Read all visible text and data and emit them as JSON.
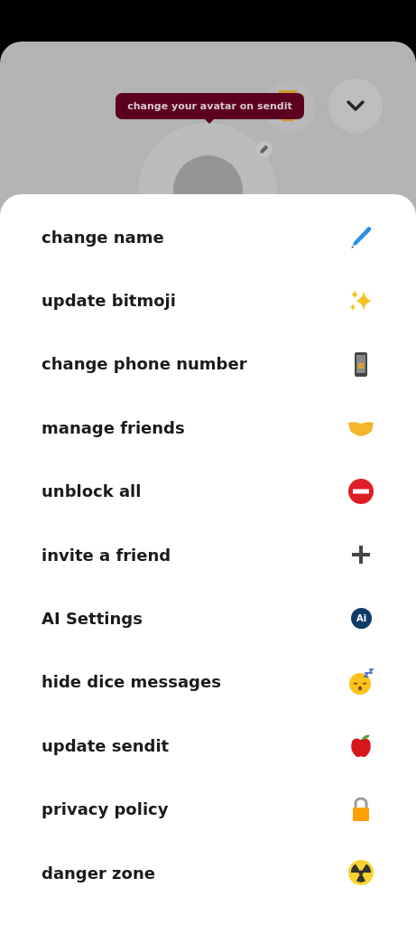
{
  "tooltip": "change your avatar on sendit",
  "menu": [
    {
      "label": "change name",
      "kind": "pencil"
    },
    {
      "label": "update bitmoji",
      "kind": "sparkles"
    },
    {
      "label": "change phone number",
      "kind": "phone"
    },
    {
      "label": "manage friends",
      "kind": "handshake"
    },
    {
      "label": "unblock all",
      "kind": "noentry"
    },
    {
      "label": "invite a friend",
      "kind": "plus"
    },
    {
      "label": "AI Settings",
      "kind": "badge",
      "badge": "Ai"
    },
    {
      "label": "hide dice messages",
      "kind": "sleepy"
    },
    {
      "label": "update sendit",
      "kind": "apple"
    },
    {
      "label": "privacy policy",
      "kind": "lock"
    },
    {
      "label": "danger zone",
      "kind": "radioactive"
    }
  ]
}
